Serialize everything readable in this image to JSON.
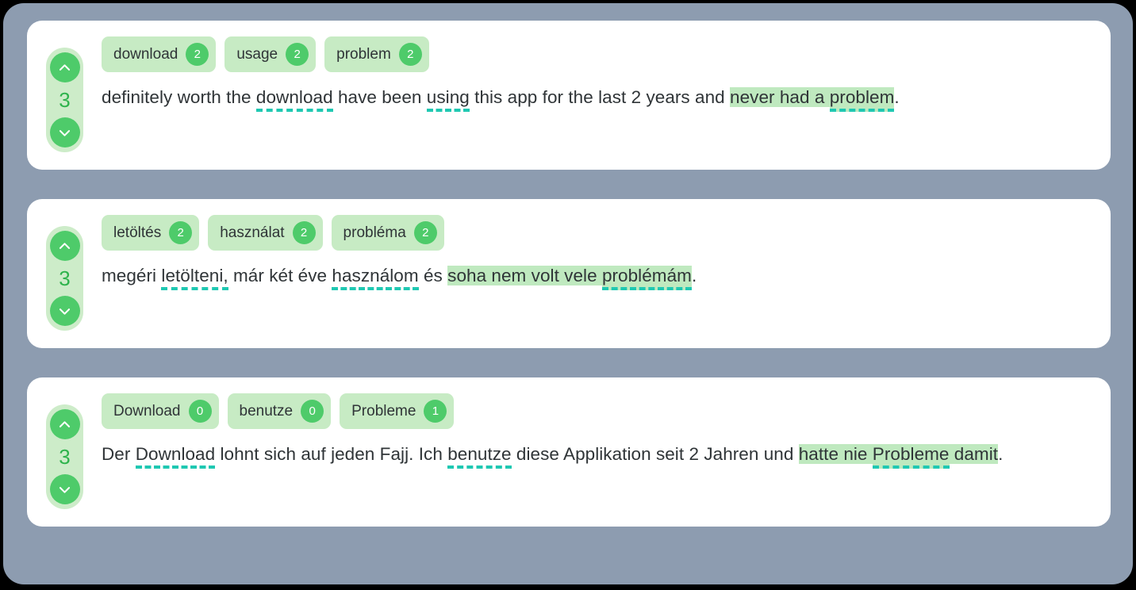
{
  "theme": {
    "page_background": "#8d9cb0",
    "card_background": "#ffffff",
    "chip_background": "#c7ebc4",
    "badge_background": "#4ecb6a",
    "vote_pill_background": "#cdecc9",
    "vote_count_color": "#2eb34c",
    "highlight_color": "#bfe9bf",
    "underline_color": "#1fc8b2",
    "text_color": "#2f3437"
  },
  "icons": {
    "upvote": "chevron-up-icon",
    "downvote": "chevron-down-icon"
  },
  "cards": [
    {
      "id": "card-english",
      "vote_count": "3",
      "chips": [
        {
          "label": "download",
          "count": "2"
        },
        {
          "label": "usage",
          "count": "2"
        },
        {
          "label": "problem",
          "count": "2"
        }
      ],
      "sentence": {
        "plain_text": "definitely worth the download have been using this app for the last 2 years and never had a problem.",
        "segments": [
          {
            "text": "definitely worth the ",
            "highlight": false,
            "underline": false
          },
          {
            "text": "download",
            "highlight": false,
            "underline": true
          },
          {
            "text": " have been ",
            "highlight": false,
            "underline": false
          },
          {
            "text": "using",
            "highlight": false,
            "underline": true
          },
          {
            "text": " this app for the last 2 years and ",
            "highlight": false,
            "underline": false
          },
          {
            "text": "never had a ",
            "highlight": true,
            "underline": false
          },
          {
            "text": "problem",
            "highlight": true,
            "underline": true
          },
          {
            "text": ".",
            "highlight": false,
            "underline": false
          }
        ]
      }
    },
    {
      "id": "card-hungarian",
      "vote_count": "3",
      "chips": [
        {
          "label": "letöltés",
          "count": "2"
        },
        {
          "label": "használat",
          "count": "2"
        },
        {
          "label": "probléma",
          "count": "2"
        }
      ],
      "sentence": {
        "plain_text": "megéri letölteni, már két éve használom és soha nem volt vele problémám.",
        "segments": [
          {
            "text": "megéri ",
            "highlight": false,
            "underline": false
          },
          {
            "text": "letölteni,",
            "highlight": false,
            "underline": true
          },
          {
            "text": " már két éve ",
            "highlight": false,
            "underline": false
          },
          {
            "text": "használom",
            "highlight": false,
            "underline": true
          },
          {
            "text": " és ",
            "highlight": false,
            "underline": false
          },
          {
            "text": "soha nem volt vele ",
            "highlight": true,
            "underline": false
          },
          {
            "text": "problémám",
            "highlight": true,
            "underline": true
          },
          {
            "text": ".",
            "highlight": false,
            "underline": false
          }
        ]
      }
    },
    {
      "id": "card-german",
      "vote_count": "3",
      "chips": [
        {
          "label": "Download",
          "count": "0"
        },
        {
          "label": "benutze",
          "count": "0"
        },
        {
          "label": "Probleme",
          "count": "1"
        }
      ],
      "sentence": {
        "plain_text": "Der Download lohnt sich auf jeden Fajj. Ich benutze diese Applikation seit 2 Jahren und hatte nie Probleme damit.",
        "segments": [
          {
            "text": "Der ",
            "highlight": false,
            "underline": false
          },
          {
            "text": "Download",
            "highlight": false,
            "underline": true
          },
          {
            "text": " lohnt sich auf jeden Fajj. Ich ",
            "highlight": false,
            "underline": false
          },
          {
            "text": "benutze",
            "highlight": false,
            "underline": true
          },
          {
            "text": " diese Applikation seit 2 Jahren und ",
            "highlight": false,
            "underline": false
          },
          {
            "text": "hatte nie ",
            "highlight": true,
            "underline": false
          },
          {
            "text": "Probleme",
            "highlight": true,
            "underline": true
          },
          {
            "text": " damit",
            "highlight": true,
            "underline": false
          },
          {
            "text": ".",
            "highlight": false,
            "underline": false
          }
        ]
      }
    }
  ]
}
